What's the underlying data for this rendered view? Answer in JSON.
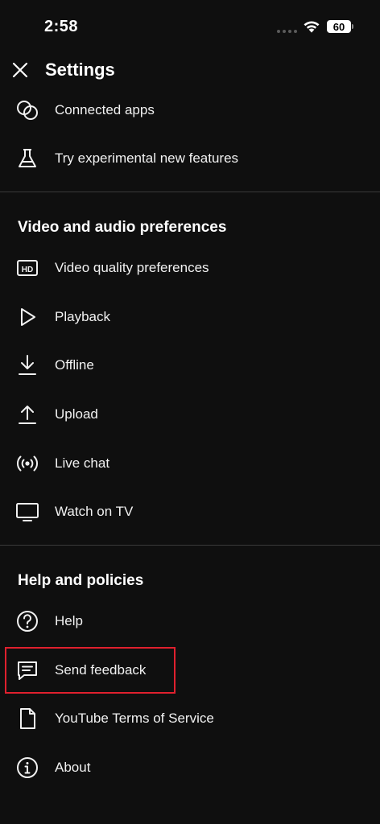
{
  "status_bar": {
    "time": "2:58",
    "battery": "60"
  },
  "header": {
    "title": "Settings",
    "close_icon": "close-icon"
  },
  "menu_top": [
    {
      "label": "Connected apps",
      "icon": "connected-apps-icon"
    },
    {
      "label": "Try experimental new features",
      "icon": "flask-icon"
    }
  ],
  "video_section": {
    "title": "Video and audio preferences",
    "items": [
      {
        "label": "Video quality preferences",
        "icon": "hd-icon"
      },
      {
        "label": "Playback",
        "icon": "play-icon"
      },
      {
        "label": "Offline",
        "icon": "download-icon"
      },
      {
        "label": "Upload",
        "icon": "upload-icon"
      },
      {
        "label": "Live chat",
        "icon": "live-icon"
      },
      {
        "label": "Watch on TV",
        "icon": "tv-icon"
      }
    ]
  },
  "help_section": {
    "title": "Help and policies",
    "items": [
      {
        "label": "Help",
        "icon": "help-icon"
      },
      {
        "label": "Send feedback",
        "icon": "feedback-icon"
      },
      {
        "label": "YouTube Terms of Service",
        "icon": "document-icon"
      },
      {
        "label": "About",
        "icon": "info-icon"
      }
    ]
  },
  "colors": {
    "background": "#0f0f0f",
    "text": "#f1f1f1",
    "divider": "#3a3a3a",
    "highlight": "#e0202e"
  }
}
